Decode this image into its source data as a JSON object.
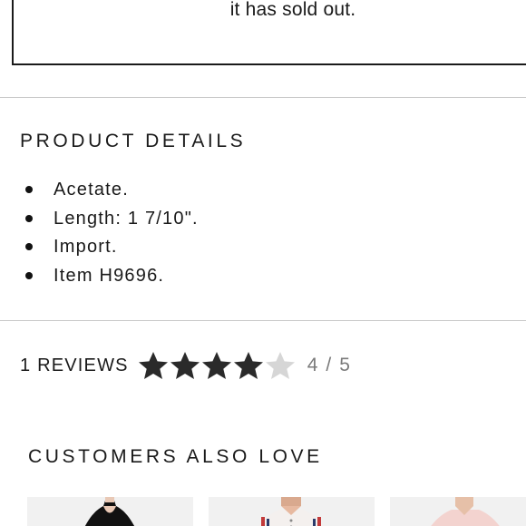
{
  "soldout": {
    "text": "it has sold out."
  },
  "product_details": {
    "title": "PRODUCT DETAILS",
    "items": [
      "Acetate.",
      "Length: 1 7/10\".",
      "Import.",
      "Item H9696."
    ]
  },
  "reviews": {
    "count_label": "1 REVIEWS",
    "rating": 4,
    "rating_max": 5,
    "rating_text": "4 / 5",
    "star_color_filled": "#2a2a2a",
    "star_color_empty": "#d6d6d6"
  },
  "customers_also_love": {
    "title": "CUSTOMERS ALSO LOVE",
    "products": [
      {
        "icon": "product-thumbnail"
      },
      {
        "icon": "product-thumbnail"
      },
      {
        "icon": "product-thumbnail"
      }
    ]
  }
}
